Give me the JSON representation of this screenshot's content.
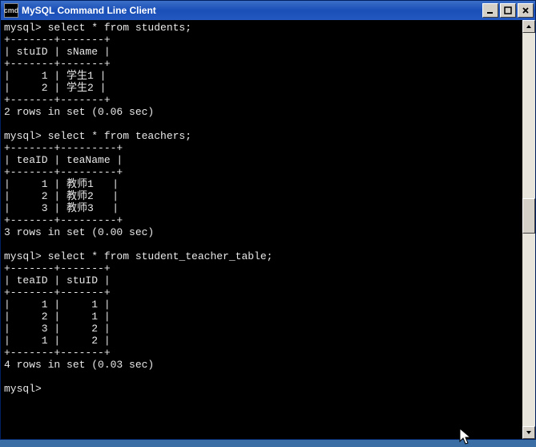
{
  "window": {
    "title": "MySQL Command Line Client",
    "icon_text": "cmd"
  },
  "console": {
    "prompt": "mysql>",
    "queries": [
      {
        "sql": "select * from students;",
        "sep": "+-------+-------+",
        "header": "| stuID | sName |",
        "rows": [
          "|     1 | 学生1 |",
          "|     2 | 学生2 |"
        ],
        "footer": "2 rows in set (0.06 sec)"
      },
      {
        "sql": "select * from teachers;",
        "sep": "+-------+---------+",
        "header": "| teaID | teaName |",
        "rows": [
          "|     1 | 教师1   |",
          "|     2 | 教师2   |",
          "|     3 | 教师3   |"
        ],
        "footer": "3 rows in set (0.00 sec)"
      },
      {
        "sql": "select * from student_teacher_table;",
        "sep": "+-------+-------+",
        "header": "| teaID | stuID |",
        "rows": [
          "|     1 |     1 |",
          "|     2 |     1 |",
          "|     3 |     2 |",
          "|     1 |     2 |"
        ],
        "footer": "4 rows in set (0.03 sec)"
      }
    ],
    "final_prompt": "mysql>"
  }
}
